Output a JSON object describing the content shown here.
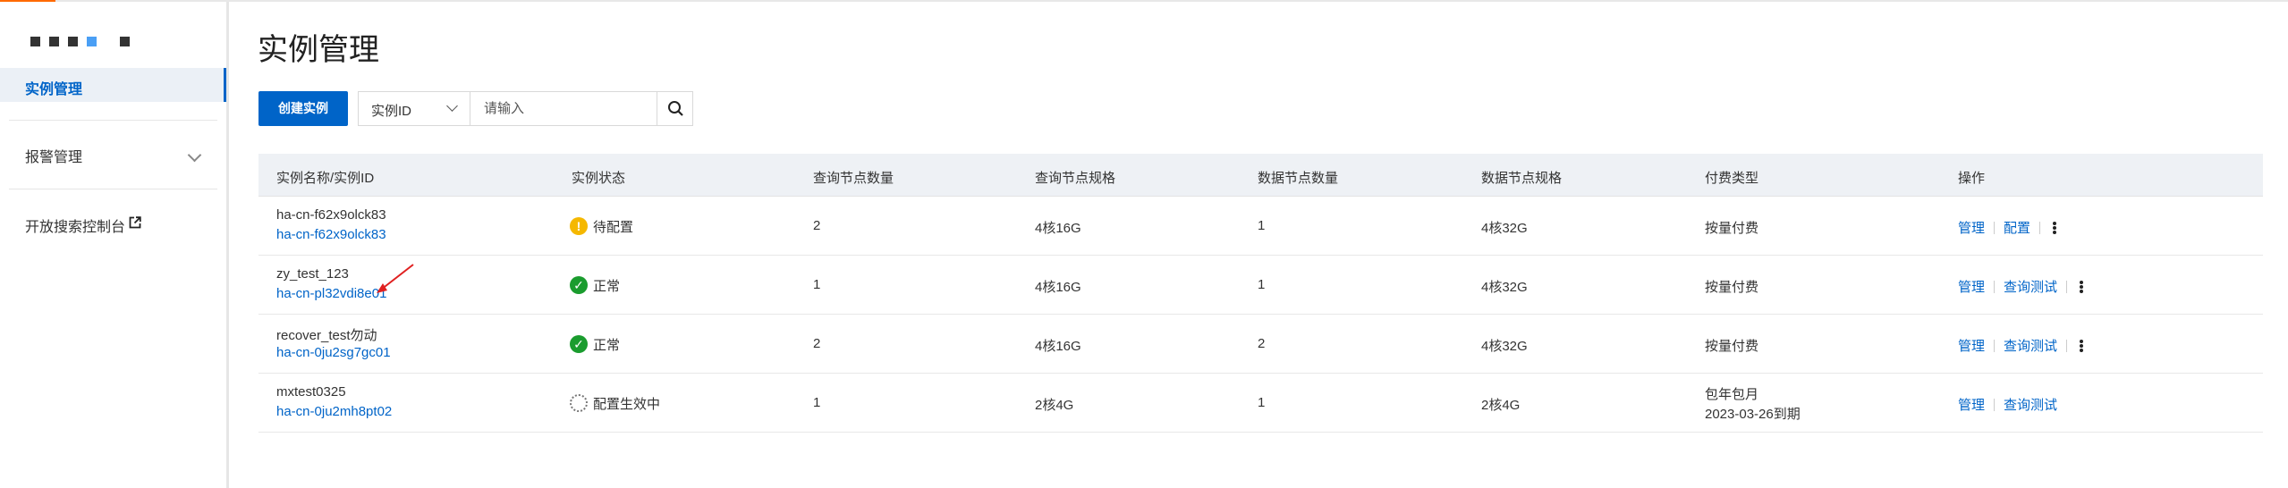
{
  "sidebar": {
    "active_item": "实例管理",
    "alert_item": "报警管理",
    "console_link": "开放搜索控制台"
  },
  "page": {
    "title": "实例管理",
    "create_button": "创建实例",
    "filter_select": "实例ID",
    "search_placeholder": "请输入"
  },
  "table": {
    "headers": [
      "实例名称/实例ID",
      "实例状态",
      "查询节点数量",
      "查询节点规格",
      "数据节点数量",
      "数据节点规格",
      "付费类型",
      "操作"
    ],
    "rows": [
      {
        "name": "ha-cn-f62x9olck83",
        "id": "ha-cn-f62x9olck83",
        "status": "待配置",
        "status_icon": "warning-icon",
        "query_nodes": "2",
        "query_spec": "4核16G",
        "data_nodes": "1",
        "data_spec": "4核32G",
        "billing": "按量付费",
        "billing2": "",
        "op1": "管理",
        "op2": "配置"
      },
      {
        "name": "zy_test_123",
        "id": "ha-cn-pl32vdi8e01",
        "status": "正常",
        "status_icon": "check-icon",
        "query_nodes": "1",
        "query_spec": "4核16G",
        "data_nodes": "1",
        "data_spec": "4核32G",
        "billing": "按量付费",
        "billing2": "",
        "op1": "管理",
        "op2": "查询测试"
      },
      {
        "name": "recover_test勿动",
        "id": "ha-cn-0ju2sg7gc01",
        "status": "正常",
        "status_icon": "check-icon",
        "query_nodes": "2",
        "query_spec": "4核16G",
        "data_nodes": "2",
        "data_spec": "4核32G",
        "billing": "按量付费",
        "billing2": "",
        "op1": "管理",
        "op2": "查询测试"
      },
      {
        "name": "mxtest0325",
        "id": "ha-cn-0ju2mh8pt02",
        "status": "配置生效中",
        "status_icon": "loading-icon",
        "query_nodes": "1",
        "query_spec": "2核4G",
        "data_nodes": "1",
        "data_spec": "2核4G",
        "billing": "包年包月",
        "billing2": "2023-03-26到期",
        "op1": "管理",
        "op2": "查询测试"
      }
    ]
  },
  "colors": {
    "primary": "#0064c8",
    "brand_accent": "#ff6a00",
    "status_ok": "#1a9c2e",
    "status_warning": "#f5b800",
    "annotation_arrow": "#e02020"
  }
}
